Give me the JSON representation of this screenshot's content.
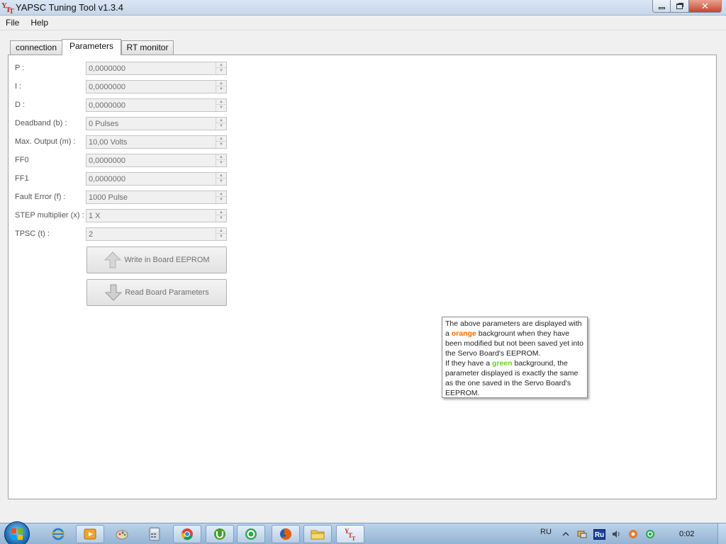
{
  "window": {
    "title": "YAPSC Tuning Tool v1.3.4",
    "icon_text": [
      "Y",
      "T",
      "T"
    ],
    "close_glyph": "✕"
  },
  "menu": [
    "File",
    "Help"
  ],
  "tabs": [
    {
      "label": "connection",
      "active": false
    },
    {
      "label": "Parameters",
      "active": true
    },
    {
      "label": "RT monitor",
      "active": false
    }
  ],
  "params": [
    {
      "label": "P :",
      "value": "0,0000000"
    },
    {
      "label": "I :",
      "value": "0,0000000"
    },
    {
      "label": "D :",
      "value": "0,0000000"
    },
    {
      "label": "Deadband (b) :",
      "value": "0 Pulses"
    },
    {
      "label": "Max. Output (m) :",
      "value": "10,00 Volts"
    },
    {
      "label": "FF0",
      "value": "0,0000000"
    },
    {
      "label": "FF1",
      "value": "0,0000000"
    },
    {
      "label": "Fault Error (f) :",
      "value": "1000 Pulse"
    },
    {
      "label": "STEP multiplier (x) :",
      "value": "1 X"
    },
    {
      "label": "TPSC (t) :",
      "value": "2"
    }
  ],
  "buttons": {
    "write": "Write in Board EEPROM",
    "read": "Read Board Parameters"
  },
  "info": {
    "t1": "The above parameters are displayed with a ",
    "orange": "orange",
    "t2": " backgrount when they have been modified but not been saved yet into the Servo Board's EEPROM.",
    "t3": "If they have a ",
    "green": "green",
    "t4": " background, the parameter displayed is exactly the same as the one saved in the Servo Board's EEPROM."
  },
  "colors": {
    "orange": "#ef6c00",
    "green": "#6ad11f",
    "app_icon": "#c62828"
  },
  "taskbar": {
    "pinned": [
      "internet-explorer-icon",
      "media-player-icon",
      "paint-icon",
      "calculator-icon",
      "chrome-icon",
      "utorrent-icon",
      "green-circle-app-icon",
      "firefox-icon",
      "file-explorer-icon",
      "yapsc-app-icon"
    ],
    "tray_lang": "RU",
    "tray_ru": "Ru",
    "clock": "0:02"
  }
}
